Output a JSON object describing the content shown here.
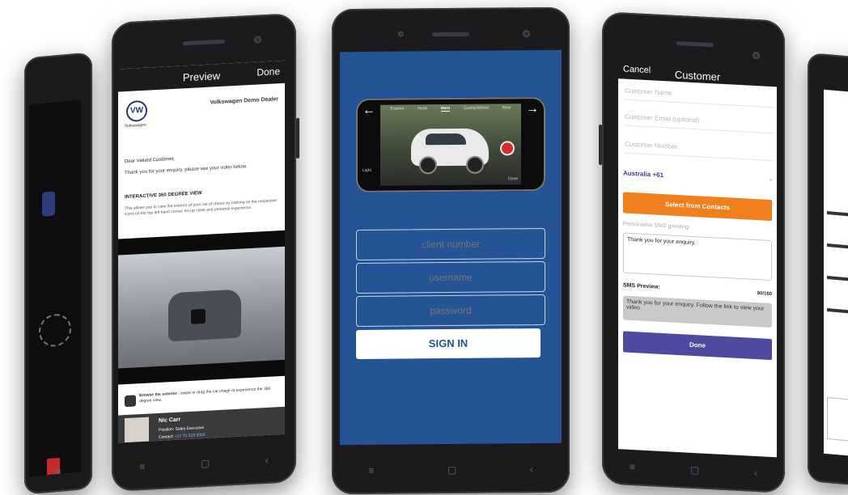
{
  "preview_phone": {
    "title": "Preview",
    "done_label": "Done",
    "dealer_logo_text": "Volkswagen",
    "dealer_name": "Volkswagen Demo Dealer",
    "greeting": "Dear Valued Customer,",
    "intro": "Thank you for your enquiry, please see your video below.",
    "section_heading": "INTERACTIVE 360 DEGREE VIEW",
    "section_body": "This allows you to view the exterior of your car of choice by clicking on the respective icons on the top left hand corner. An up close and personal experience.",
    "browse_title": "Browse the exterior",
    "browse_body": " - swipe or drag the car image to experience the 360 degree view.",
    "rep_name": "Nic Carr",
    "rep_position_label": "Position:",
    "rep_position": "Sales Executive",
    "rep_contact_label": "Contact:",
    "rep_contact": "+27 71 528 8006"
  },
  "login_phone": {
    "camera_tabs": [
      "Exterior",
      "Nose",
      "Hero",
      "Quality/Wheel",
      "Rear"
    ],
    "camera_side_label": "Light",
    "camera_done": "Done",
    "client_number_placeholder": "client number",
    "username_placeholder": "username",
    "password_placeholder": "password",
    "sign_in_label": "SIGN IN"
  },
  "customer_phone": {
    "cancel_label": "Cancel",
    "title": "Customer",
    "name_placeholder": "Customer Name",
    "email_placeholder": "Customer Email (optional)",
    "number_placeholder": "Customer Number",
    "country": "Australia +61",
    "select_contacts_label": "Select from Contacts",
    "greeting_label": "Personalise SMS greeting:",
    "greeting_value": "Thank you for your enquiry.",
    "sms_preview_label": "SMS Preview:",
    "sms_count": "90/160",
    "sms_preview_text": "Thank you for your enquiry. Follow the link to view your video",
    "done_label": "Done"
  },
  "colors": {
    "login_background": "#245396",
    "orange_button": "#f07f1e",
    "purple_button": "#4d4aa0",
    "vw_blue": "#1d3d7a"
  }
}
